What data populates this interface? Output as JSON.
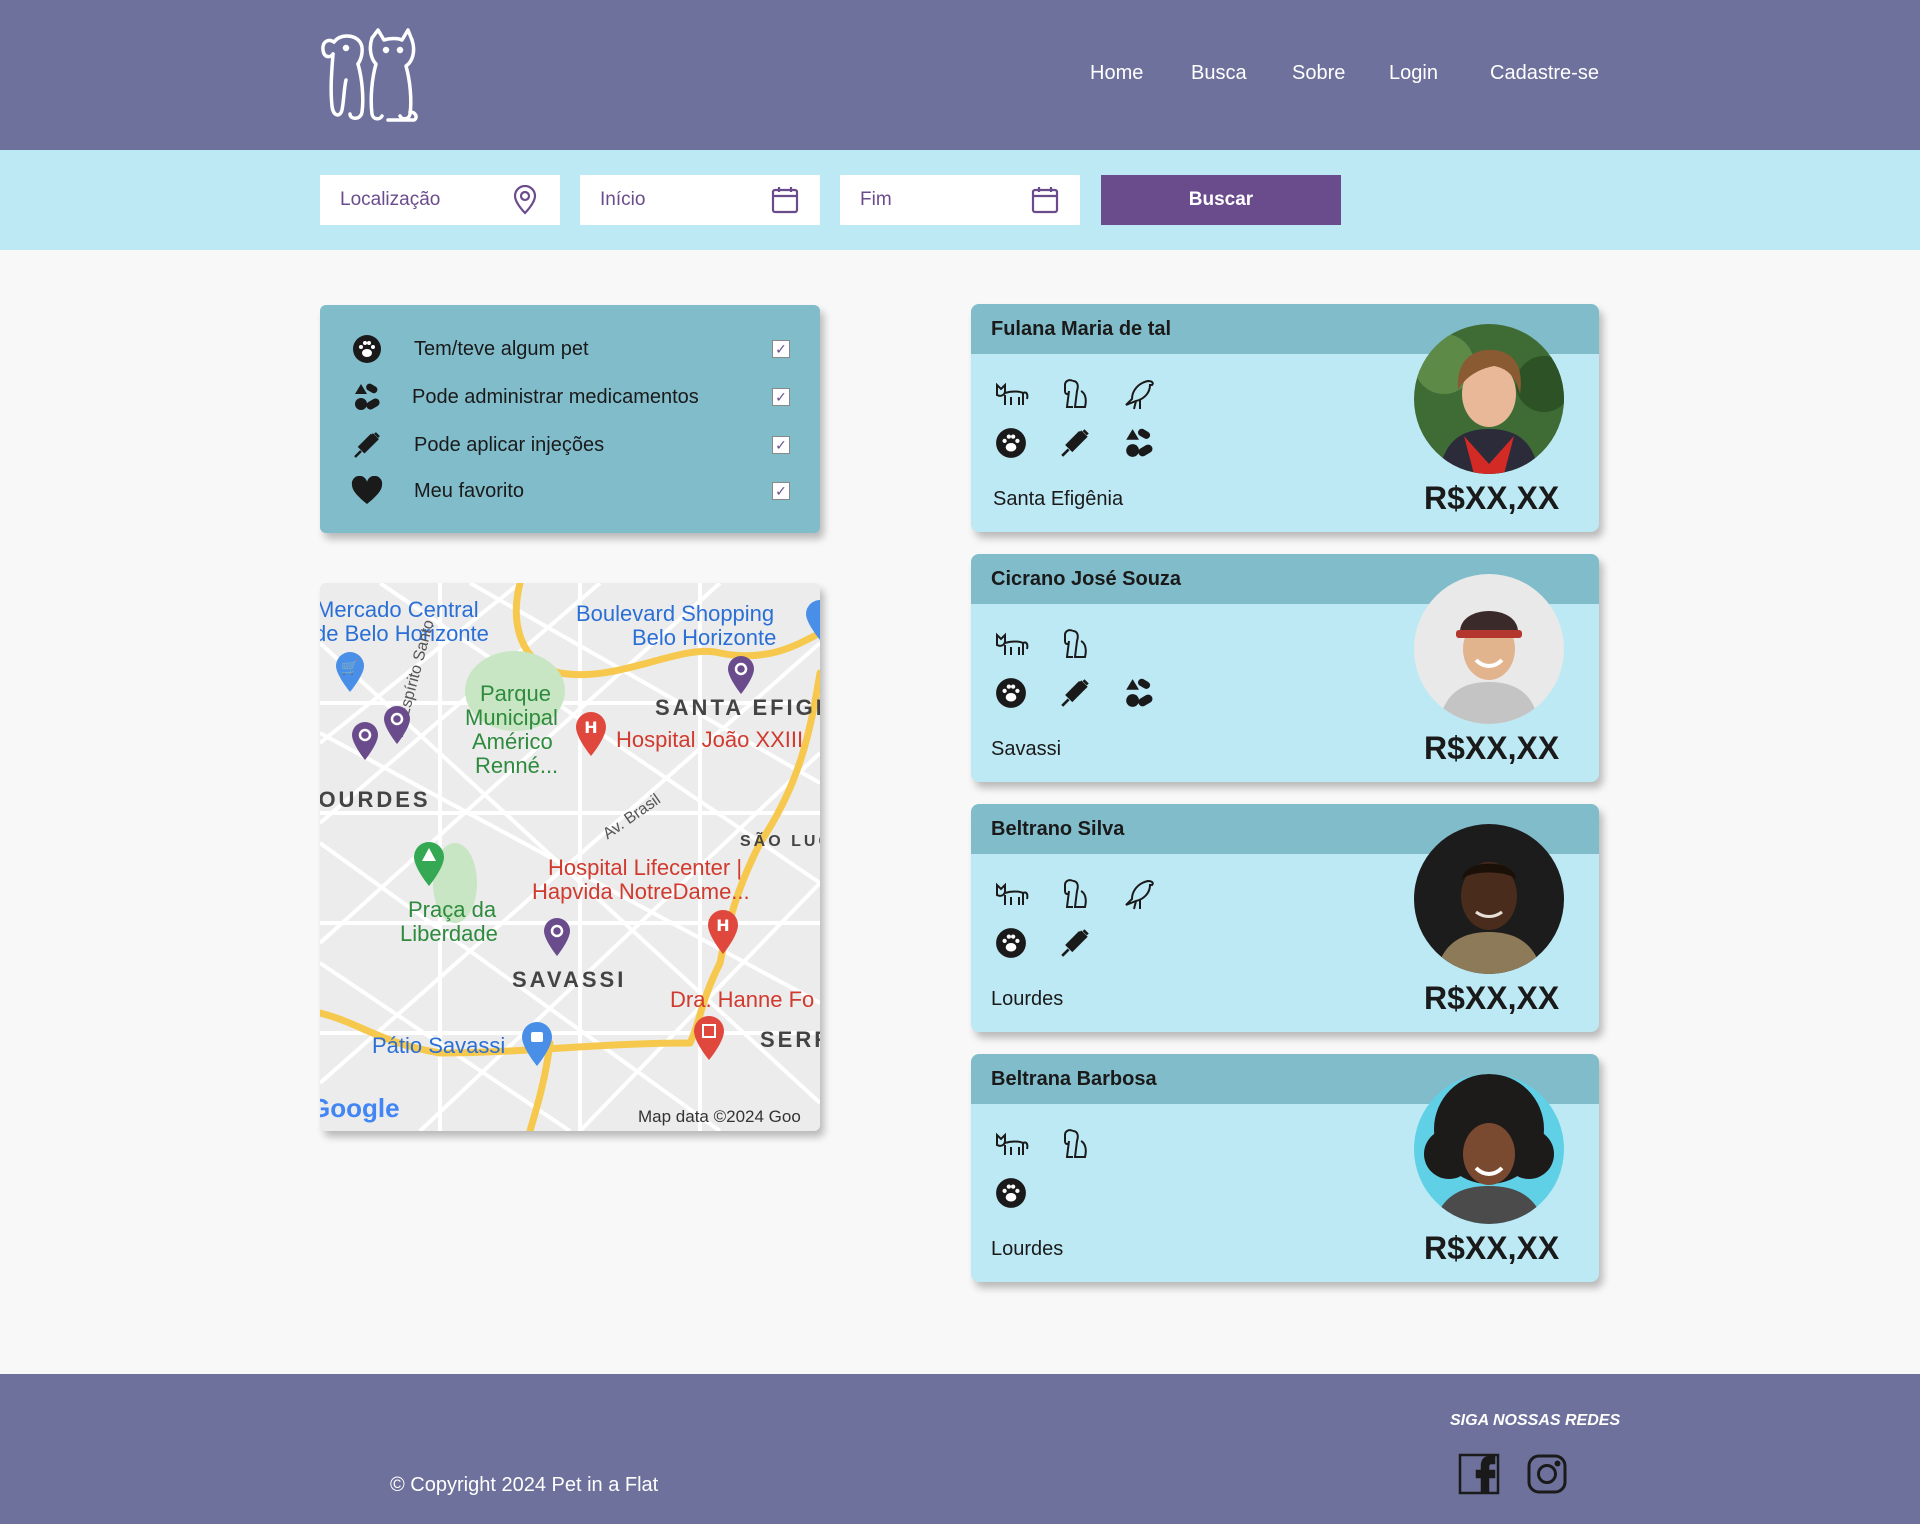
{
  "header": {
    "logo": "pet-logo-icon",
    "nav": [
      "Home",
      "Busca",
      "Sobre",
      "Login",
      "Cadastre-se"
    ]
  },
  "search": {
    "location_placeholder": "Localização",
    "start_placeholder": "Início",
    "end_placeholder": "Fim",
    "button": "Buscar"
  },
  "filters": [
    {
      "icon": "paw-icon",
      "label": "Tem/teve algum pet",
      "checked": true
    },
    {
      "icon": "pills-icon",
      "label": "Pode administrar medicamentos",
      "checked": true
    },
    {
      "icon": "syringe-icon",
      "label": "Pode aplicar injeções",
      "checked": true
    },
    {
      "icon": "heart-icon",
      "label": "Meu favorito",
      "checked": true
    }
  ],
  "map": {
    "labels": {
      "mercado1": "Mercado Central",
      "mercado2": "de Belo Horizonte",
      "boulevard1": "Boulevard Shopping",
      "boulevard2": "Belo Horizonte",
      "parque1": "Parque",
      "parque2": "Municipal",
      "parque3": "Américo",
      "parque4": "Renné...",
      "santa": "SANTA EFIGÊ",
      "hospital_joao": "Hospital João XXIII",
      "rua_espirito": "R. Espírito Santo",
      "lourdes": "LOURDES",
      "av_brasil": "Av. Brasil",
      "sao_luc": "SÃO LUC",
      "lifecenter1": "Hospital Lifecenter |",
      "lifecenter2": "Hapvida NotreDame...",
      "praca1": "Praça da",
      "praca2": "Liberdade",
      "savassi": "SAVASSI",
      "dra": "Dra. Hanne Fo",
      "patio": "Pátio Savassi",
      "serr": "SERR",
      "google": "Google",
      "mapdata": "Map data ©2024 Goo"
    }
  },
  "cards": [
    {
      "name": "Fulana Maria de tal",
      "location": "Santa Efigênia",
      "price": "R$XX,XX",
      "pets": [
        "cat-icon",
        "dog-icon",
        "bird-icon"
      ],
      "skills": [
        "paw-icon",
        "syringe-icon",
        "pills-icon"
      ]
    },
    {
      "name": "Cicrano José Souza",
      "location": "Savassi",
      "price": "R$XX,XX",
      "pets": [
        "cat-icon",
        "dog-icon"
      ],
      "skills": [
        "paw-icon",
        "syringe-icon",
        "pills-icon"
      ]
    },
    {
      "name": "Beltrano Silva",
      "location": "Lourdes",
      "price": "R$XX,XX",
      "pets": [
        "cat-icon",
        "dog-icon",
        "bird-icon"
      ],
      "skills": [
        "paw-icon",
        "syringe-icon"
      ]
    },
    {
      "name": "Beltrana Barbosa",
      "location": "Lourdes",
      "price": "R$XX,XX",
      "pets": [
        "cat-icon",
        "dog-icon"
      ],
      "skills": [
        "paw-icon"
      ]
    }
  ],
  "footer": {
    "social_title": "SIGA NOSSAS REDES",
    "copyright": "© Copyright 2024 Pet in a Flat",
    "social": [
      "facebook-icon",
      "instagram-icon"
    ]
  },
  "colors": {
    "header": "#6e719b",
    "searchbar": "#bde9f5",
    "accent": "#6a4c8c",
    "panel": "#81bccb",
    "card": "#bde9f5"
  }
}
